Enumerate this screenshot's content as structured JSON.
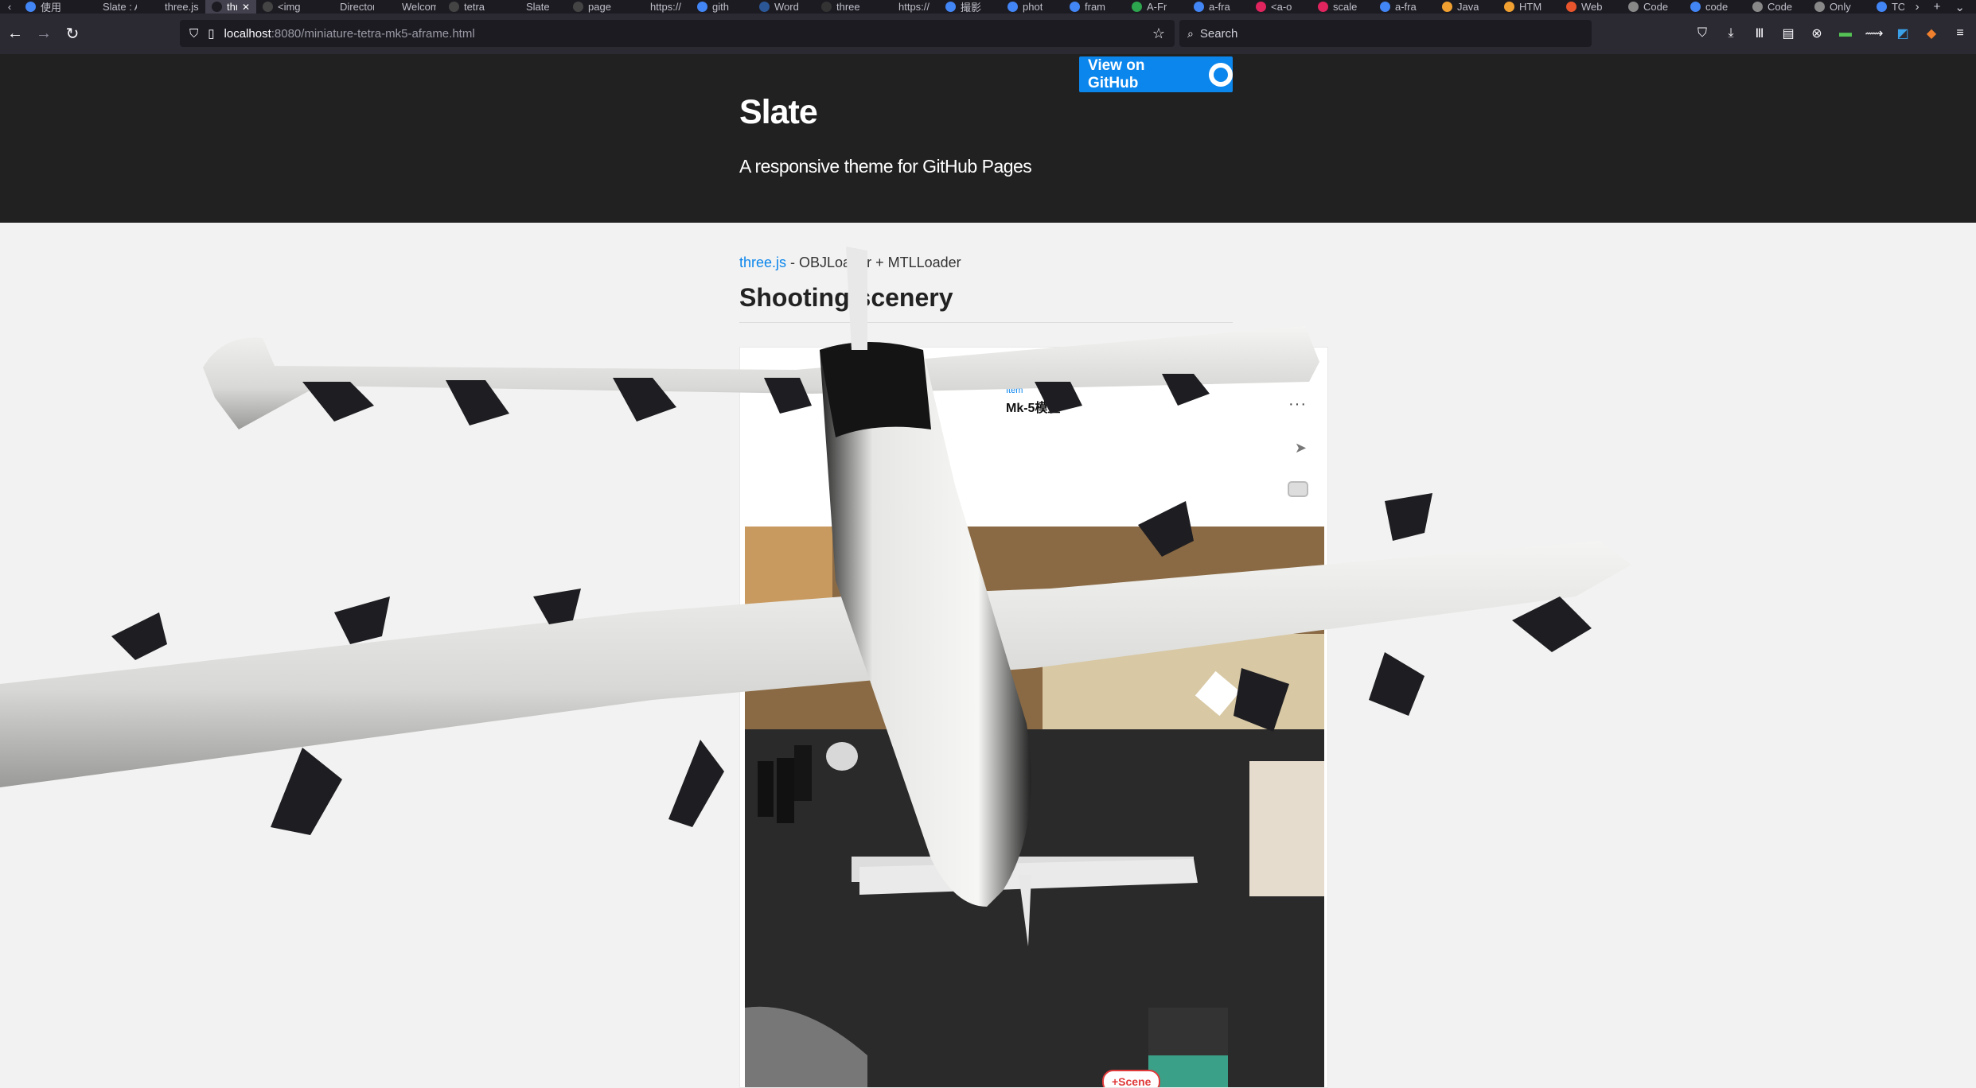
{
  "browser": {
    "tabs": [
      {
        "label": "使用",
        "favicon_color": "#4285f4"
      },
      {
        "label": "Slate : A",
        "favicon_color": "#1c1b22"
      },
      {
        "label": "three.js",
        "favicon_color": "#1c1b22"
      },
      {
        "label": "three",
        "favicon_color": "#1c1b22",
        "active": true
      },
      {
        "label": "<img",
        "favicon_color": "#444444"
      },
      {
        "label": "Director",
        "favicon_color": "#1c1b22"
      },
      {
        "label": "Welcom",
        "favicon_color": "#1c1b22"
      },
      {
        "label": "tetra",
        "favicon_color": "#444444"
      },
      {
        "label": "Slate",
        "favicon_color": "#1c1b22"
      },
      {
        "label": "page",
        "favicon_color": "#444444"
      },
      {
        "label": "https://",
        "favicon_color": "#1c1b22"
      },
      {
        "label": "gith",
        "favicon_color": "#4285f4"
      },
      {
        "label": "Word",
        "favicon_color": "#2b5797"
      },
      {
        "label": "three",
        "favicon_color": "#333333"
      },
      {
        "label": "https://",
        "favicon_color": "#1c1b22"
      },
      {
        "label": "撮影",
        "favicon_color": "#4285f4"
      },
      {
        "label": "phot",
        "favicon_color": "#4285f4"
      },
      {
        "label": "fram",
        "favicon_color": "#4285f4"
      },
      {
        "label": "A-Fr",
        "favicon_color": "#2da44e"
      },
      {
        "label": "a-fra",
        "favicon_color": "#4285f4"
      },
      {
        "label": "<a-o",
        "favicon_color": "#e0245e"
      },
      {
        "label": "scale",
        "favicon_color": "#e0245e"
      },
      {
        "label": "a-fra",
        "favicon_color": "#4285f4"
      },
      {
        "label": "Java",
        "favicon_color": "#f0a030"
      },
      {
        "label": "HTM",
        "favicon_color": "#f0a030"
      },
      {
        "label": "Web",
        "favicon_color": "#e8552d"
      },
      {
        "label": "Code",
        "favicon_color": "#888888"
      },
      {
        "label": "code",
        "favicon_color": "#4285f4"
      },
      {
        "label": "Code",
        "favicon_color": "#888888"
      },
      {
        "label": "Only",
        "favicon_color": "#888888"
      },
      {
        "label": "TOH",
        "favicon_color": "#4285f4"
      }
    ],
    "close_glyph": "✕",
    "url_host": "localhost",
    "url_rest": ":8080/miniature-tetra-mk5-aframe.html",
    "search_placeholder": "Search"
  },
  "header": {
    "github_button": "View on GitHub",
    "title": "Slate",
    "tagline": "A responsive theme for GitHub Pages"
  },
  "main": {
    "info_link": "three.js",
    "info_text": " - OBJLoader + MTLLoader",
    "heading": "Shooting scenery"
  },
  "embed": {
    "category": "Item",
    "name": "Mk-5模型",
    "scene_button": "+Scene"
  },
  "colors": {
    "header_bg": "#212121",
    "accent": "#0b86ec",
    "scene_red": "#e03a3a"
  }
}
